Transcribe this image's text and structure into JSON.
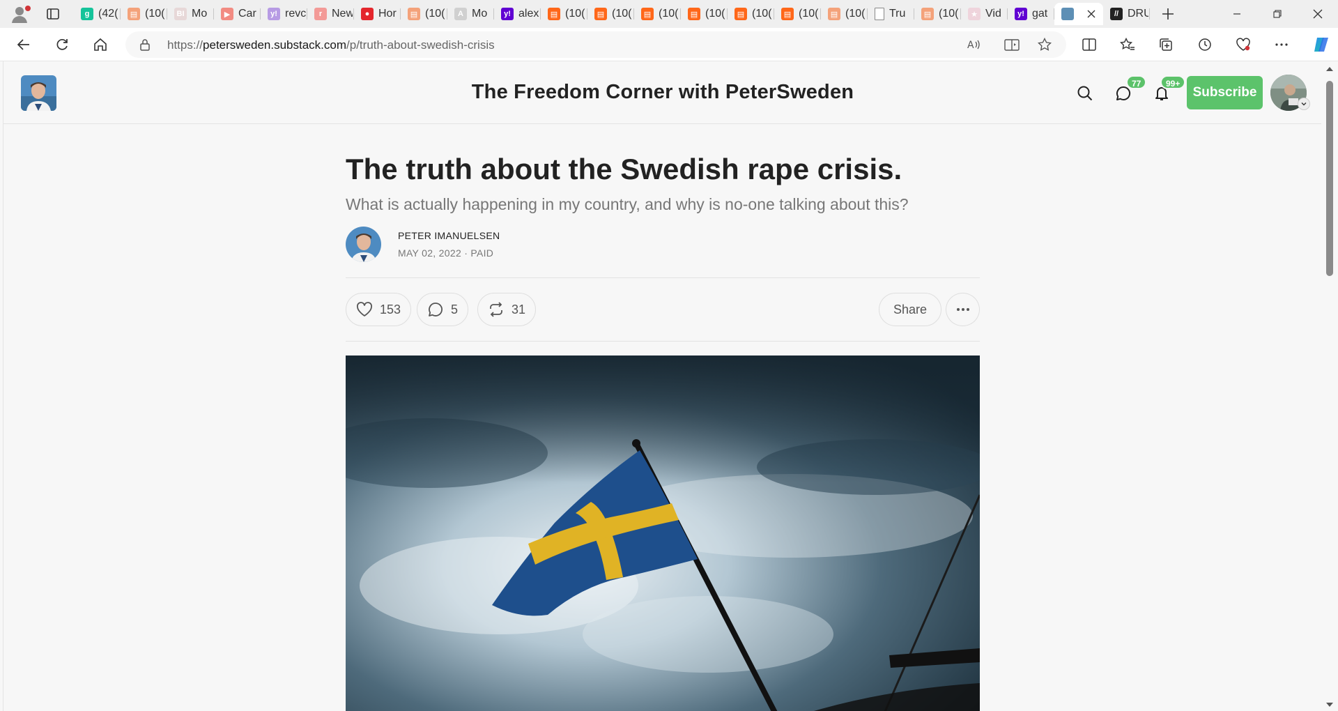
{
  "browser": {
    "tabs": [
      {
        "label": "(42(",
        "icon": "grammarly-icon",
        "color": "#15c39a",
        "glyph": "g"
      },
      {
        "label": "(10(",
        "icon": "substack-icon",
        "color": "#f4a27a",
        "glyph": "▤"
      },
      {
        "label": "Mo",
        "icon": "bi-icon",
        "color": "#e7d8d8",
        "glyph": "BI"
      },
      {
        "label": "Car",
        "icon": "youtube-icon",
        "color": "#f28b82",
        "glyph": "▶"
      },
      {
        "label": "revc",
        "icon": "yahoo-icon",
        "color": "#b79be4",
        "glyph": "y!"
      },
      {
        "label": "New",
        "icon": "reddit-icon",
        "color": "#f39a97",
        "glyph": "r"
      },
      {
        "label": "Hor",
        "icon": "news-icon",
        "color": "#e4262c",
        "glyph": "●"
      },
      {
        "label": "(10(",
        "icon": "substack-icon",
        "color": "#f4a27a",
        "glyph": "▤"
      },
      {
        "label": "Mo",
        "icon": "ai-icon",
        "color": "#d0d0d0",
        "glyph": "A"
      },
      {
        "label": "alex",
        "icon": "yahoo-icon",
        "color": "#6001d2",
        "glyph": "y!"
      },
      {
        "label": "(10(",
        "icon": "substack-icon",
        "color": "#ff6719",
        "glyph": "▤"
      },
      {
        "label": "(10(",
        "icon": "substack-icon",
        "color": "#ff6719",
        "glyph": "▤"
      },
      {
        "label": "(10(",
        "icon": "substack-icon",
        "color": "#ff6719",
        "glyph": "▤"
      },
      {
        "label": "(10(",
        "icon": "substack-icon",
        "color": "#ff6719",
        "glyph": "▤"
      },
      {
        "label": "(10(",
        "icon": "substack-icon",
        "color": "#ff6719",
        "glyph": "▤"
      },
      {
        "label": "(10(",
        "icon": "substack-icon",
        "color": "#ff6719",
        "glyph": "▤"
      },
      {
        "label": "(10(",
        "icon": "substack-icon",
        "color": "#f4a27a",
        "glyph": "▤"
      },
      {
        "label": "Tru",
        "icon": "page-icon",
        "color": "#ffffff",
        "glyph": ""
      },
      {
        "label": "(10(",
        "icon": "substack-icon",
        "color": "#f4a27a",
        "glyph": "▤"
      },
      {
        "label": "Vid",
        "icon": "star-icon",
        "color": "#efd4dc",
        "glyph": "★"
      },
      {
        "label": "gat",
        "icon": "yahoo-icon",
        "color": "#6001d2",
        "glyph": "y!"
      },
      {
        "label": "",
        "icon": "peter-avatar-icon",
        "color": "#5d8fb5",
        "glyph": "",
        "active": true
      },
      {
        "label": "DRU",
        "icon": "drudge-icon",
        "color": "#222222",
        "glyph": "//"
      }
    ],
    "url_host": "petersweden.substack.com",
    "url_prefix": "https://",
    "url_path": "/p/truth-about-swedish-crisis"
  },
  "site": {
    "title": "The Freedom Corner with PeterSweden",
    "messages_badge": "77",
    "notifications_badge": "99+",
    "subscribe_label": "Subscribe"
  },
  "post": {
    "title": "The truth about the Swedish rape crisis.",
    "subtitle": "What is actually happening in my country, and why is no-one talking about this?",
    "author": "PETER IMANUELSEN",
    "meta": "MAY 02, 2022 · PAID",
    "likes": "153",
    "comments": "5",
    "restacks": "31",
    "share_label": "Share"
  },
  "colors": {
    "accent": "#5cc36b",
    "flag_blue": "#1e4f8c",
    "flag_yellow": "#e0b325"
  }
}
